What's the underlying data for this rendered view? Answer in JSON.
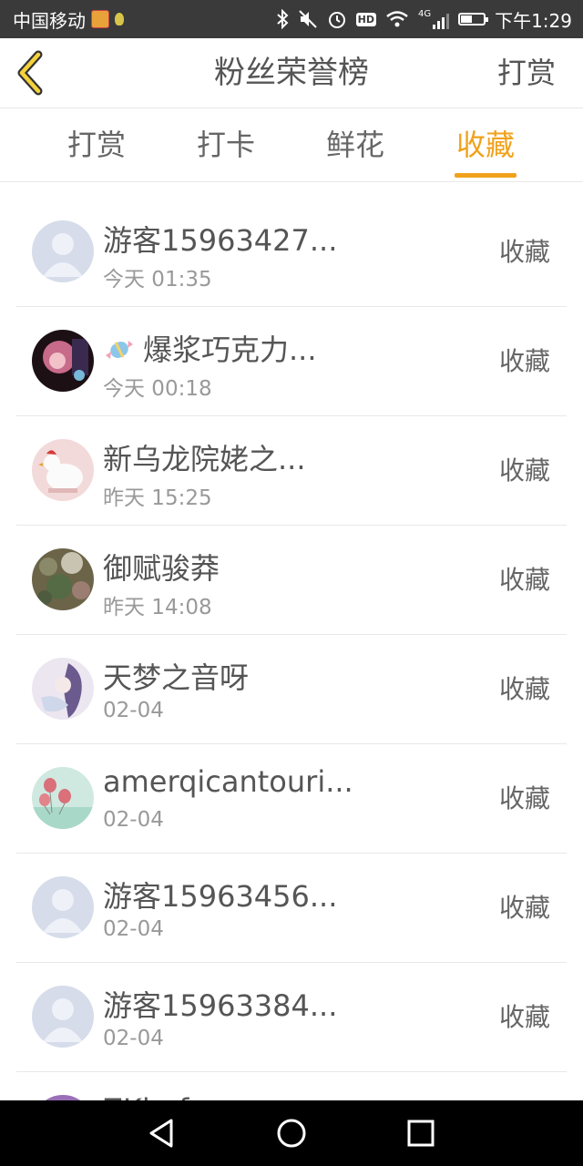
{
  "status_bar": {
    "carrier": "中国移动",
    "time": "下午1:29",
    "network": "4G",
    "hd": "HD",
    "battery_level": 0.45
  },
  "header": {
    "back_icon": "chevron-left-icon",
    "title": "粉丝荣誉榜",
    "action": "打赏"
  },
  "tabs": [
    {
      "label": "打赏",
      "active": false
    },
    {
      "label": "打卡",
      "active": false
    },
    {
      "label": "鲜花",
      "active": false
    },
    {
      "label": "收藏",
      "active": true
    }
  ],
  "list": [
    {
      "name": "游客15963427...",
      "time": "今天 01:35",
      "action": "收藏",
      "avatar": "default"
    },
    {
      "name": "爆浆巧克力...",
      "time": "今天 00:18",
      "action": "收藏",
      "avatar": "anime-girl"
    },
    {
      "name": "新乌龙院姥之...",
      "time": "昨天 15:25",
      "action": "收藏",
      "avatar": "chicken"
    },
    {
      "name": "御赋骏莽",
      "time": "昨天 14:08",
      "action": "收藏",
      "avatar": "moss"
    },
    {
      "name": "天梦之音呀",
      "time": "02-04",
      "action": "收藏",
      "avatar": "anime-purple"
    },
    {
      "name": "amerqicantouri...",
      "time": "02-04",
      "action": "收藏",
      "avatar": "balloons"
    },
    {
      "name": "游客15963456...",
      "time": "02-04",
      "action": "收藏",
      "avatar": "default"
    },
    {
      "name": "游客15963384...",
      "time": "02-04",
      "action": "收藏",
      "avatar": "default"
    },
    {
      "name": "ZKimfe",
      "time": "",
      "action": "",
      "avatar": "purple"
    }
  ],
  "nav": {
    "back": "triangle-back-icon",
    "home": "circle-home-icon",
    "recents": "square-recents-icon"
  }
}
